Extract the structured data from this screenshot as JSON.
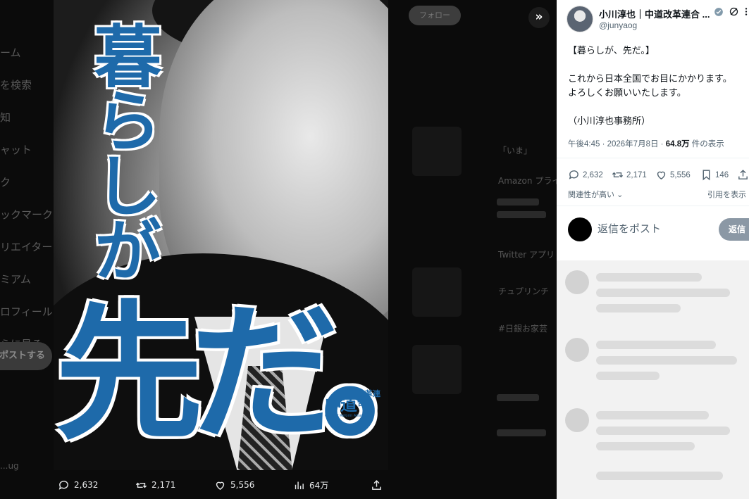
{
  "background": {
    "nav_items": [
      "ーム",
      "を検索",
      "知",
      "ャット",
      "ク",
      "ックマーク",
      "リエイター",
      "ミアム",
      "ロフィール",
      "らに見る"
    ],
    "post_button": "ポストする",
    "follow_button": "フォロー",
    "user_label": "...ug",
    "side_items": [
      "「いま」",
      "Amazon プライム",
      "Twitter アプリ",
      "チュプリンチ",
      "#日銀お家芸"
    ]
  },
  "poster": {
    "vertical_text": "暮らしが",
    "big_text": "先だ。",
    "logo_main": "中道",
    "logo_sub": "改革連合",
    "logo_en": "Centrist Reform Alliance"
  },
  "media_actions": {
    "replies": "2,632",
    "reposts": "2,171",
    "likes": "5,556",
    "views": "64万"
  },
  "tweet": {
    "author": "小川淳也｜中道改革連合 ...",
    "handle": "@junyaog",
    "text": "【暮らしが、先だ。】\n\nこれから日本全国でお目にかかります。\nよろしくお願いいたします。\n\n（小川淳也事務所）",
    "time": "午後4:45 · 2026年7月8日 · ",
    "views_count": "64.8万",
    "views_label": " 件の表示",
    "stats": {
      "replies": "2,632",
      "reposts": "2,171",
      "likes": "5,556",
      "bookmarks": "146"
    },
    "sort_label": "関連性が高い",
    "quote_label": "引用を表示",
    "reply_placeholder": "返信をポスト",
    "reply_button": "返信"
  },
  "colors": {
    "accent": "#1e6aaa",
    "muted": "#536471"
  }
}
